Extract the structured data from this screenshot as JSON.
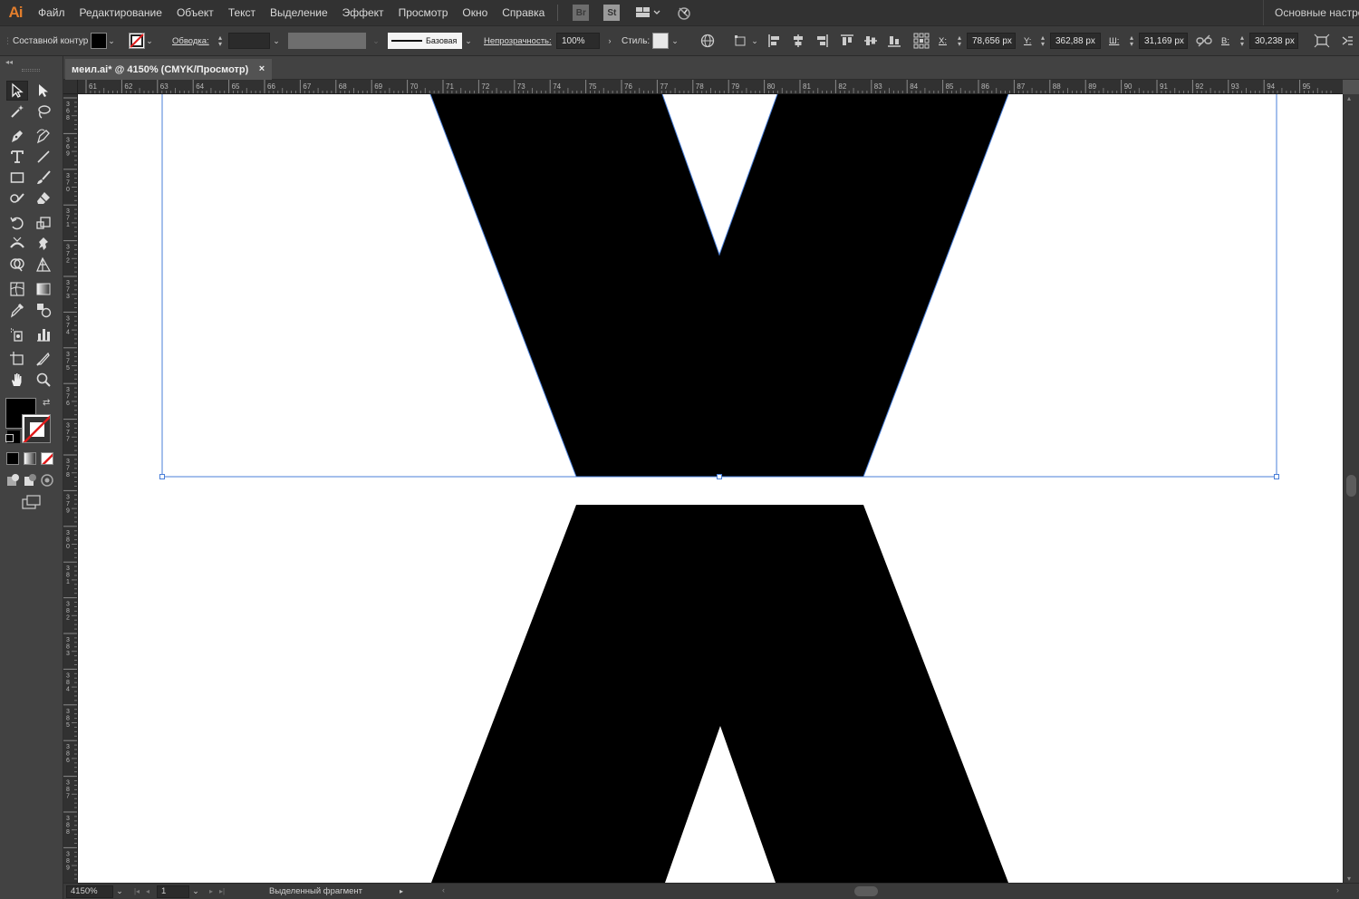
{
  "app": {
    "logo": "Ai",
    "menu": [
      "Файл",
      "Редактирование",
      "Объект",
      "Текст",
      "Выделение",
      "Эффект",
      "Просмотр",
      "Окно",
      "Справка"
    ],
    "bridge_icon": "Br",
    "stock_icon": "St",
    "workspace": "Основные настро"
  },
  "control": {
    "selection_type": "Составной контур",
    "fill_color": "#000000",
    "stroke_label": "Обводка:",
    "stroke_weight": "",
    "profile_label": "Базовая",
    "opacity_label": "Непрозрачность:",
    "opacity_value": "100%",
    "style_label": "Стиль:",
    "x_label": "X:",
    "x_value": "78,656 px",
    "y_label": "Y:",
    "y_value": "362,88 px",
    "w_label": "Ш:",
    "w_value": "31,169 px",
    "h_label": "В:",
    "h_value": "30,238 px"
  },
  "document": {
    "tab_title": "меил.ai* @ 4150% (CMYK/Просмотр)",
    "close_glyph": "×"
  },
  "rulers": {
    "h_labels": [
      "61",
      "62",
      "63",
      "64",
      "65",
      "66",
      "67",
      "68",
      "69",
      "70",
      "71",
      "72",
      "73",
      "74",
      "75",
      "76",
      "77",
      "78",
      "79",
      "80",
      "81",
      "82",
      "83",
      "84",
      "85",
      "86",
      "87",
      "88",
      "89",
      "90",
      "91",
      "92",
      "93",
      "94",
      "95"
    ],
    "v_labels": [
      "368",
      "369",
      "370",
      "371",
      "372",
      "373",
      "374",
      "375",
      "376",
      "377",
      "378",
      "379",
      "380",
      "381",
      "382",
      "383",
      "384",
      "385",
      "386",
      "387",
      "388",
      "389"
    ]
  },
  "status": {
    "zoom": "4150%",
    "artboard": "1",
    "info": "Выделенный фрагмент"
  },
  "colors": {
    "accent_logo": "#e37e2c",
    "selection": "#4a7fd8",
    "fill": "#000000"
  }
}
